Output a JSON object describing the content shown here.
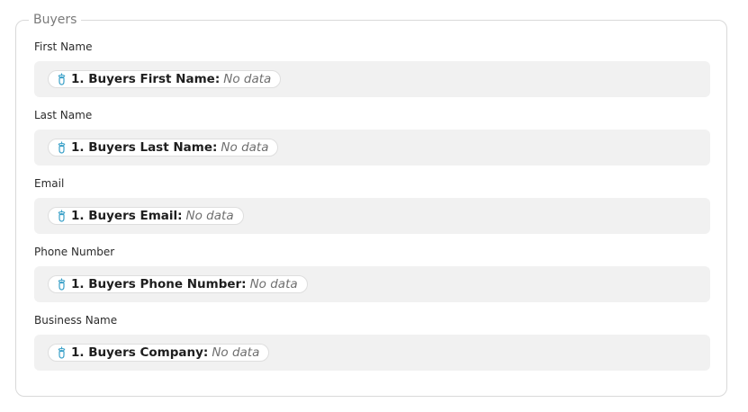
{
  "section": {
    "legend": "Buyers"
  },
  "fields": [
    {
      "label": "First Name",
      "token": "1. Buyers First Name",
      "value": "No data"
    },
    {
      "label": "Last Name",
      "token": "1. Buyers Last Name",
      "value": "No data"
    },
    {
      "label": "Email",
      "token": "1. Buyers Email",
      "value": "No data"
    },
    {
      "label": "Phone Number",
      "token": "1. Buyers Phone Number",
      "value": "No data"
    },
    {
      "label": "Business Name",
      "token": "1. Buyers Company",
      "value": "No data"
    }
  ],
  "token_icon": "step-trigger-icon",
  "colors": {
    "icon": "#3aa0c8",
    "field_bg": "#f1f1f1",
    "border": "#d9d9d9"
  }
}
